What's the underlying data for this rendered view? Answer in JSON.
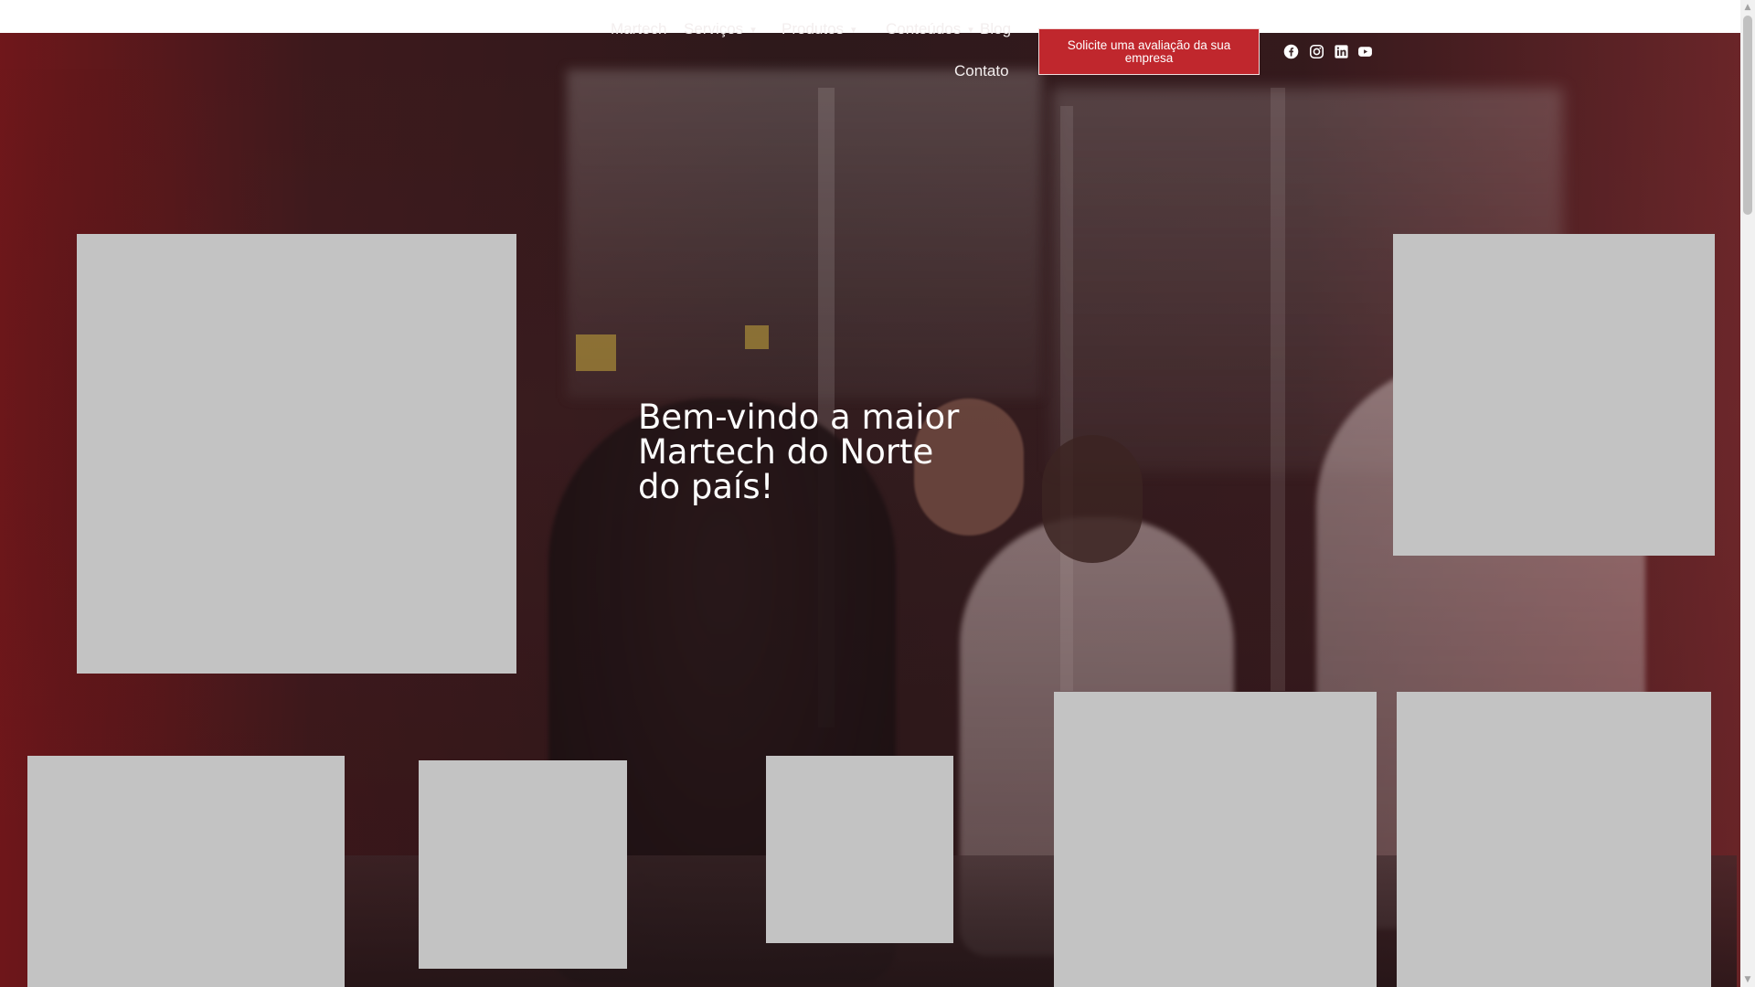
{
  "nav": {
    "items": [
      {
        "label": "Martech",
        "has_caret": false
      },
      {
        "label": "Serviços",
        "has_caret": true
      },
      {
        "label": "Produtos",
        "has_caret": true
      },
      {
        "label": "Conteúdos",
        "has_caret": true
      },
      {
        "label": "Blog",
        "has_caret": false
      },
      {
        "label": "Contato",
        "has_caret": false
      }
    ],
    "cta_label": "Solicite uma avaliação da sua empresa",
    "social": [
      "facebook-icon",
      "instagram-icon",
      "linkedin-icon",
      "youtube-icon"
    ]
  },
  "hero": {
    "title": "Bem-vindo a maior Martech do Norte do país!"
  },
  "colors": {
    "accent": "#c0272d",
    "placeholder": "#c3c3c3",
    "nav_text": "#f3eeee"
  }
}
